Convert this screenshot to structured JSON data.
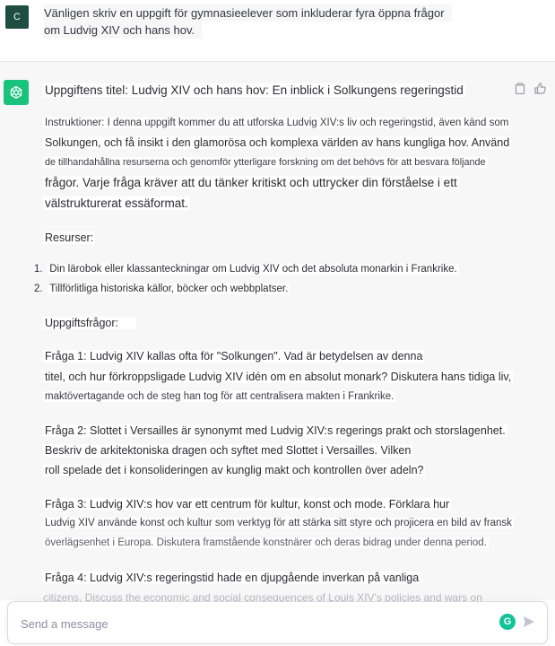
{
  "user_message": {
    "avatar_letter": "C",
    "lines": [
      "Vänligen skriv en uppgift för gymnasieelever som inkluderar fyra öppna frågor",
      "om Ludvig XIV och hans hov."
    ]
  },
  "assistant_message": {
    "title": "Uppgiftens titel: Ludvig XIV och hans hov: En inblick i Solkungens regeringstid",
    "instructions_lines": [
      "Instruktioner: I denna uppgift kommer du att utforska Ludvig XIV:s liv och regeringstid, även känd som",
      "Solkungen, och få insikt i den glamorösa och komplexa världen av hans kungliga hov. Använd",
      "de tillhandahållna resurserna och genomför ytterligare forskning om det behövs för att besvara följande",
      "frågor. Varje fråga kräver att du tänker kritiskt och uttrycker din förståelse i ett",
      "välstrukturerat essäformat."
    ],
    "resources_heading": "Resurser:",
    "resources": [
      "Din lärobok eller klassanteckningar om Ludvig XIV och det absoluta monarkin i Frankrike.",
      "Tillförlitliga historiska källor, böcker och webbplatser."
    ],
    "questions_heading": "Uppgiftsfrågor:",
    "q1_lines": [
      "Fråga 1: Ludvig XIV kallas ofta för \"Solkungen\". Vad är betydelsen av denna",
      "titel, och hur förkroppsligade Ludvig XIV idén om en absolut monark? Diskutera hans tidiga liv,",
      "maktövertagande och de steg han tog för att centralisera makten i Frankrike."
    ],
    "q2_lines": [
      "Fråga 2: Slottet i Versailles är synonymt med Ludvig XIV:s regerings prakt och storslagenhet.",
      "Beskriv de arkitektoniska dragen och syftet med Slottet i Versailles. Vilken",
      "roll spelade det i konsolideringen av kunglig makt och kontrollen över adeln?"
    ],
    "q3_lines": [
      "Fråga 3: Ludvig XIV:s hov var ett centrum för kultur, konst och mode. Förklara hur",
      "Ludvig XIV använde konst och kultur som verktyg för att stärka sitt styre och projicera en bild av fransk",
      "överlägsenhet i Europa. Diskutera framstående konstnärer och deras bidrag under denna period."
    ],
    "q4_lines": [
      "Fråga 4: Ludvig XIV:s regeringstid hade en djupgående inverkan på vanliga",
      "citizens. Discuss the economic and social consequences of Louis XIV's policies and wars on"
    ]
  },
  "composer": {
    "placeholder": "Send a message",
    "value": ""
  },
  "icons": {
    "assistant_avatar": "openai-logo-icon",
    "copy": "clipboard-icon",
    "like": "thumbs-up-icon",
    "grammarly": "grammarly-icon",
    "send": "send-icon"
  },
  "colors": {
    "assistant_avatar_bg": "#19c37d",
    "user_avatar_bg": "#1e4d42",
    "assistant_row_bg": "#f7f7f8",
    "grammarly": "#15c39a"
  }
}
